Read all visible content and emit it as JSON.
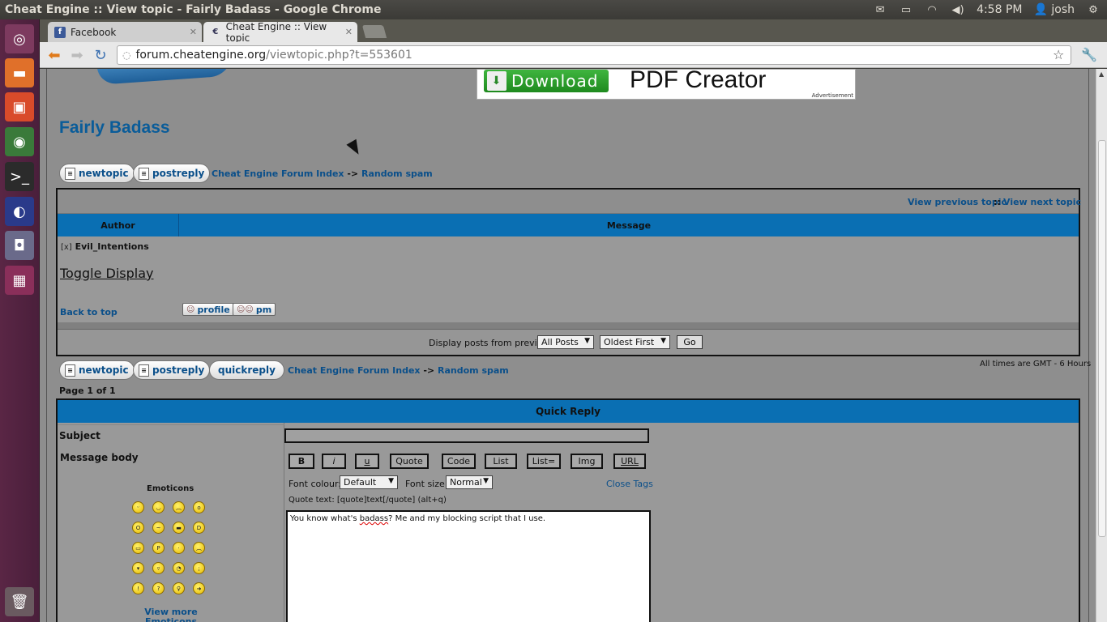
{
  "window": {
    "title": "Cheat Engine :: View topic - Fairly Badass - Google Chrome"
  },
  "tray": {
    "time": "4:58 PM",
    "user": "josh"
  },
  "tabs": [
    {
      "label": "Facebook",
      "icon": "facebook-icon"
    },
    {
      "label": "Cheat Engine :: View topic",
      "icon": "cheatengine-icon"
    }
  ],
  "address": {
    "host": "forum.cheatengine.org",
    "path": "/viewtopic.php?t=553601"
  },
  "ad": {
    "download": "Download",
    "title": "PDF Creator",
    "note": "Advertisement"
  },
  "topic": {
    "title": "Fairly Badass",
    "new_topic": "newtopic",
    "post_reply": "postreply",
    "quick_reply": "quickreply",
    "crumb_index": "Cheat Engine Forum Index",
    "crumb_sep": "->",
    "crumb_forum": "Random spam"
  },
  "nav": {
    "prev": "View previous topic",
    "sep": "::",
    "next": "View next topic"
  },
  "table": {
    "col_author": "Author",
    "col_message": "Message"
  },
  "post": {
    "collapse": "[x]",
    "author": "Evil_Intentions",
    "toggle": "Toggle Display",
    "back_to_top": "Back to top",
    "profile": "profile",
    "pm": "pm"
  },
  "display": {
    "label": "Display posts from previous:",
    "range": "All Posts",
    "order": "Oldest First",
    "go": "Go"
  },
  "times_note": "All times are GMT - 6 Hours",
  "page_count": "Page 1 of 1",
  "quick": {
    "header": "Quick Reply",
    "subject_label": "Subject",
    "body_label": "Message body",
    "emoticons_label": "Emoticons",
    "view_more": "View more Emoticons",
    "buttons": [
      "B",
      "i",
      "u",
      "Quote",
      "Code",
      "List",
      "List=",
      "Img",
      "URL"
    ],
    "font_colour_label": "Font colour:",
    "font_colour_value": "Default",
    "font_size_label": "Font size:",
    "font_size_value": "Normal",
    "close_tags": "Close Tags",
    "quote_help": "Quote text: [quote]text[/quote]  (alt+q)",
    "message_pre": "You know what's ",
    "message_spell": "badass",
    "message_post": "? Me and my blocking script that I use."
  }
}
